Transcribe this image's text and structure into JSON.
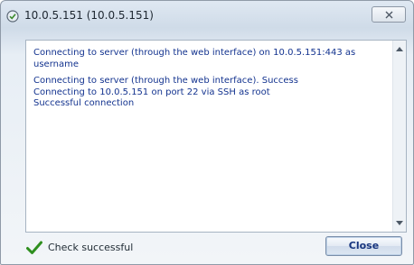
{
  "window": {
    "title": "10.0.5.151 (10.0.5.151)"
  },
  "log": {
    "lines": [
      "Connecting to server (through the web interface) on 10.0.5.151:443 as username",
      "Connecting to server (through the web interface). Success",
      "Connecting to 10.0.5.151 on port 22 via SSH as root",
      "Successful connection"
    ]
  },
  "status": {
    "text": "Check successful",
    "icon": "green-checkmark-icon"
  },
  "buttons": {
    "close_label": "Close"
  },
  "colors": {
    "log_text": "#13338f",
    "check_green": "#2f8f1f"
  }
}
